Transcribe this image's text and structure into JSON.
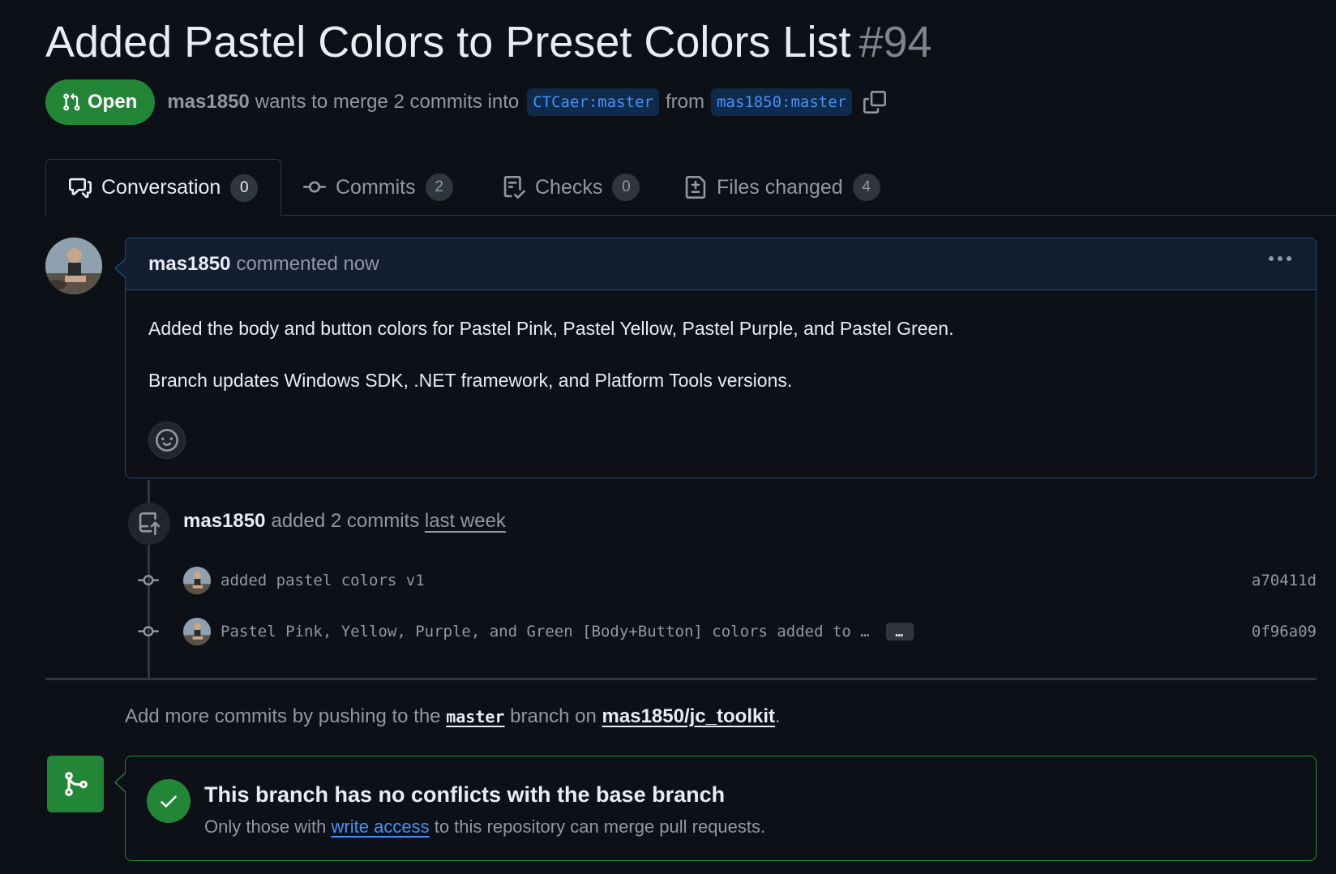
{
  "pr": {
    "title": "Added Pastel Colors to Preset Colors List",
    "number": "#94",
    "state": "Open",
    "author": "mas1850",
    "summary": "wants to merge 2 commits into",
    "base_branch": "CTCaer:master",
    "from_word": "from",
    "head_branch": "mas1850:master"
  },
  "tabs": [
    {
      "label": "Conversation",
      "count": "0",
      "icon": "comment-discussion-icon",
      "active": true
    },
    {
      "label": "Commits",
      "count": "2",
      "icon": "git-commit-icon",
      "active": false
    },
    {
      "label": "Checks",
      "count": "0",
      "icon": "checklist-icon",
      "active": false
    },
    {
      "label": "Files changed",
      "count": "4",
      "icon": "file-diff-icon",
      "active": false
    }
  ],
  "comment": {
    "author": "mas1850",
    "action": "commented now",
    "body": [
      "Added the body and button colors for Pastel Pink, Pastel Yellow, Pastel Purple, and Pastel Green.",
      "Branch updates Windows SDK, .NET framework, and Platform Tools versions."
    ]
  },
  "commits_event": {
    "author": "mas1850",
    "action": "added 2 commits",
    "time": "last week",
    "commits": [
      {
        "message": "added pastel colors v1",
        "sha": "a70411d",
        "truncated": false
      },
      {
        "message": "Pastel Pink, Yellow, Purple, and Green [Body+Button] colors added to …",
        "sha": "0f96a09",
        "truncated": true
      }
    ],
    "expand_label": "…"
  },
  "push_hint": {
    "prefix": "Add more commits by pushing to the",
    "branch": "master",
    "middle": "branch on",
    "repo": "mas1850/jc_toolkit",
    "suffix": "."
  },
  "merge_status": {
    "title": "This branch has no conflicts with the base branch",
    "sub_prefix": "Only those with",
    "sub_link": "write access",
    "sub_suffix": "to this repository can merge pull requests."
  },
  "colors": {
    "background": "#0d1117",
    "open_green": "#238636",
    "link_blue": "#4493f8",
    "muted": "#9198a1"
  }
}
